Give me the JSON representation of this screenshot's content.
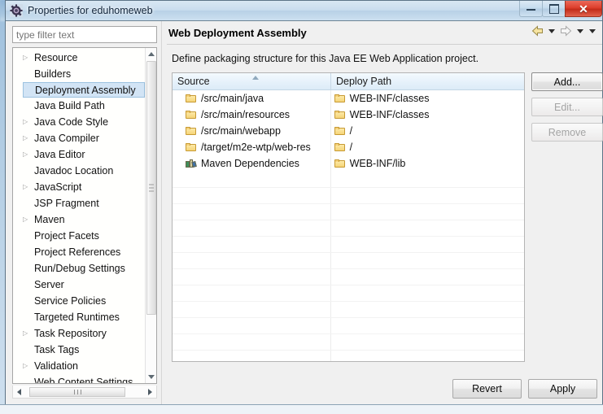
{
  "window": {
    "title": "Properties for eduhomeweb",
    "icon": "properties-gear-icon",
    "buttons": {
      "minimize": "minimize-icon",
      "maximize": "maximize-icon",
      "close": "✕"
    }
  },
  "filter": {
    "placeholder": "type filter text",
    "value": ""
  },
  "tree": {
    "items": [
      {
        "label": "Resource",
        "expandable": true,
        "selected": false
      },
      {
        "label": "Builders",
        "expandable": false,
        "selected": false
      },
      {
        "label": "Deployment Assembly",
        "expandable": false,
        "selected": true
      },
      {
        "label": "Java Build Path",
        "expandable": false,
        "selected": false
      },
      {
        "label": "Java Code Style",
        "expandable": true,
        "selected": false
      },
      {
        "label": "Java Compiler",
        "expandable": true,
        "selected": false
      },
      {
        "label": "Java Editor",
        "expandable": true,
        "selected": false
      },
      {
        "label": "Javadoc Location",
        "expandable": false,
        "selected": false
      },
      {
        "label": "JavaScript",
        "expandable": true,
        "selected": false
      },
      {
        "label": "JSP Fragment",
        "expandable": false,
        "selected": false
      },
      {
        "label": "Maven",
        "expandable": true,
        "selected": false
      },
      {
        "label": "Project Facets",
        "expandable": false,
        "selected": false
      },
      {
        "label": "Project References",
        "expandable": false,
        "selected": false
      },
      {
        "label": "Run/Debug Settings",
        "expandable": false,
        "selected": false
      },
      {
        "label": "Server",
        "expandable": false,
        "selected": false
      },
      {
        "label": "Service Policies",
        "expandable": false,
        "selected": false
      },
      {
        "label": "Targeted Runtimes",
        "expandable": false,
        "selected": false
      },
      {
        "label": "Task Repository",
        "expandable": true,
        "selected": false
      },
      {
        "label": "Task Tags",
        "expandable": false,
        "selected": false
      },
      {
        "label": "Validation",
        "expandable": true,
        "selected": false
      },
      {
        "label": "Web Content Settings",
        "expandable": false,
        "selected": false
      }
    ],
    "twisty_glyph": "▷"
  },
  "page": {
    "title": "Web Deployment Assembly",
    "description": "Define packaging structure for this Java EE Web Application project.",
    "nav": {
      "back_icon": "back-arrow-icon",
      "forward_icon": "forward-arrow-icon",
      "back_menu_icon": "chevron-down-icon",
      "forward_menu_icon": "chevron-down-icon",
      "view_menu_icon": "chevron-down-icon"
    }
  },
  "table": {
    "columns": [
      "Source",
      "Deploy Path"
    ],
    "sort": {
      "column": "Source",
      "direction": "ascending"
    },
    "rows": [
      {
        "source": "/src/main/java",
        "source_icon": "folder-icon",
        "deploy": "WEB-INF/classes",
        "deploy_icon": "folder-icon"
      },
      {
        "source": "/src/main/resources",
        "source_icon": "folder-icon",
        "deploy": "WEB-INF/classes",
        "deploy_icon": "folder-icon"
      },
      {
        "source": "/src/main/webapp",
        "source_icon": "folder-icon",
        "deploy": "/",
        "deploy_icon": "folder-icon"
      },
      {
        "source": "/target/m2e-wtp/web-res",
        "source_icon": "folder-icon",
        "deploy": "/",
        "deploy_icon": "folder-icon"
      },
      {
        "source": "Maven Dependencies",
        "source_icon": "library-icon",
        "deploy": "WEB-INF/lib",
        "deploy_icon": "folder-icon"
      }
    ],
    "empty_row_count": 12
  },
  "side_buttons": [
    {
      "label": "Add...",
      "enabled": true
    },
    {
      "label": "Edit...",
      "enabled": false
    },
    {
      "label": "Remove",
      "enabled": false
    }
  ],
  "bottom_buttons": [
    {
      "label": "Revert",
      "enabled": true
    },
    {
      "label": "Apply",
      "enabled": true
    }
  ],
  "colors": {
    "selection": "#d2e4f5",
    "header_gradient_top": "#f4fafe",
    "close_button": "#dd3f2c",
    "folder_icon": "#f6d478",
    "disabled_text": "#a4a4a4"
  }
}
